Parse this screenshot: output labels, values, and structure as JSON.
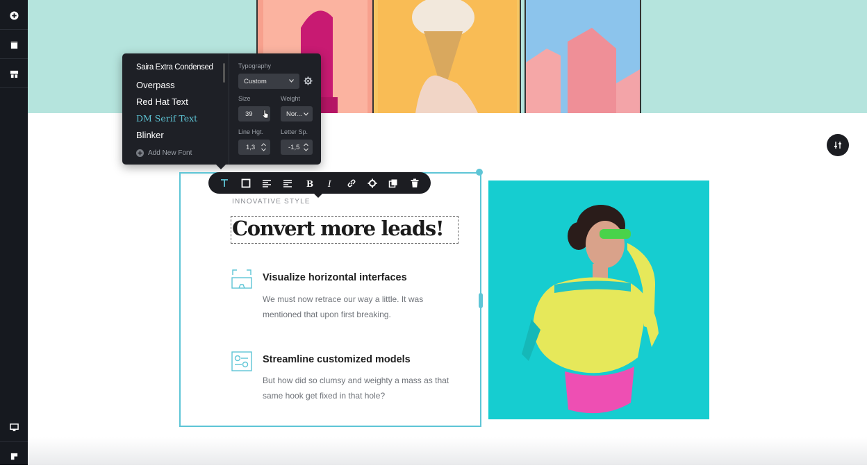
{
  "rail": {
    "icons": [
      "plus-circle-icon",
      "page-icon",
      "layout-icon",
      "desktop-icon",
      "mobile-icon"
    ]
  },
  "font_panel": {
    "fonts": [
      "Saira Extra Condensed",
      "Overpass",
      "Red Hat Text",
      "DM Serif Text",
      "Blinker"
    ],
    "selected_font": "DM Serif Text",
    "add_font_label": "Add New Font",
    "typography_label": "Typography",
    "typography_value": "Custom",
    "size_label": "Size",
    "size_value": "39",
    "weight_label": "Weight",
    "weight_value": "Nor...",
    "line_height_label": "Line Hgt.",
    "line_height_value": "1,3",
    "letter_spacing_label": "Letter Sp.",
    "letter_spacing_value": "-1,5"
  },
  "toolbar": {
    "icons": [
      "text-type-icon",
      "border-box-icon",
      "align-left-icon",
      "align-justify-icon",
      "bold-icon",
      "italic-icon",
      "link-icon",
      "settings-gear-icon",
      "duplicate-icon",
      "trash-icon"
    ]
  },
  "content": {
    "kicker": "INNOVATIVE STYLE",
    "heading": "Convert more leads!",
    "features": [
      {
        "title": "Visualize horizontal interfaces",
        "desc": "We must now retrace our way a little. It was mentioned that upon first breaking."
      },
      {
        "title": "Streamline customized models",
        "desc": "But how did so clumsy and weighty a mass as that same hook get fixed in that hole?"
      }
    ]
  },
  "colors": {
    "accent": "#5ec5d6",
    "hero_bg": "#b5e4dd",
    "panel_bg": "#1e2026",
    "photo_bg": "#16cdd0"
  }
}
